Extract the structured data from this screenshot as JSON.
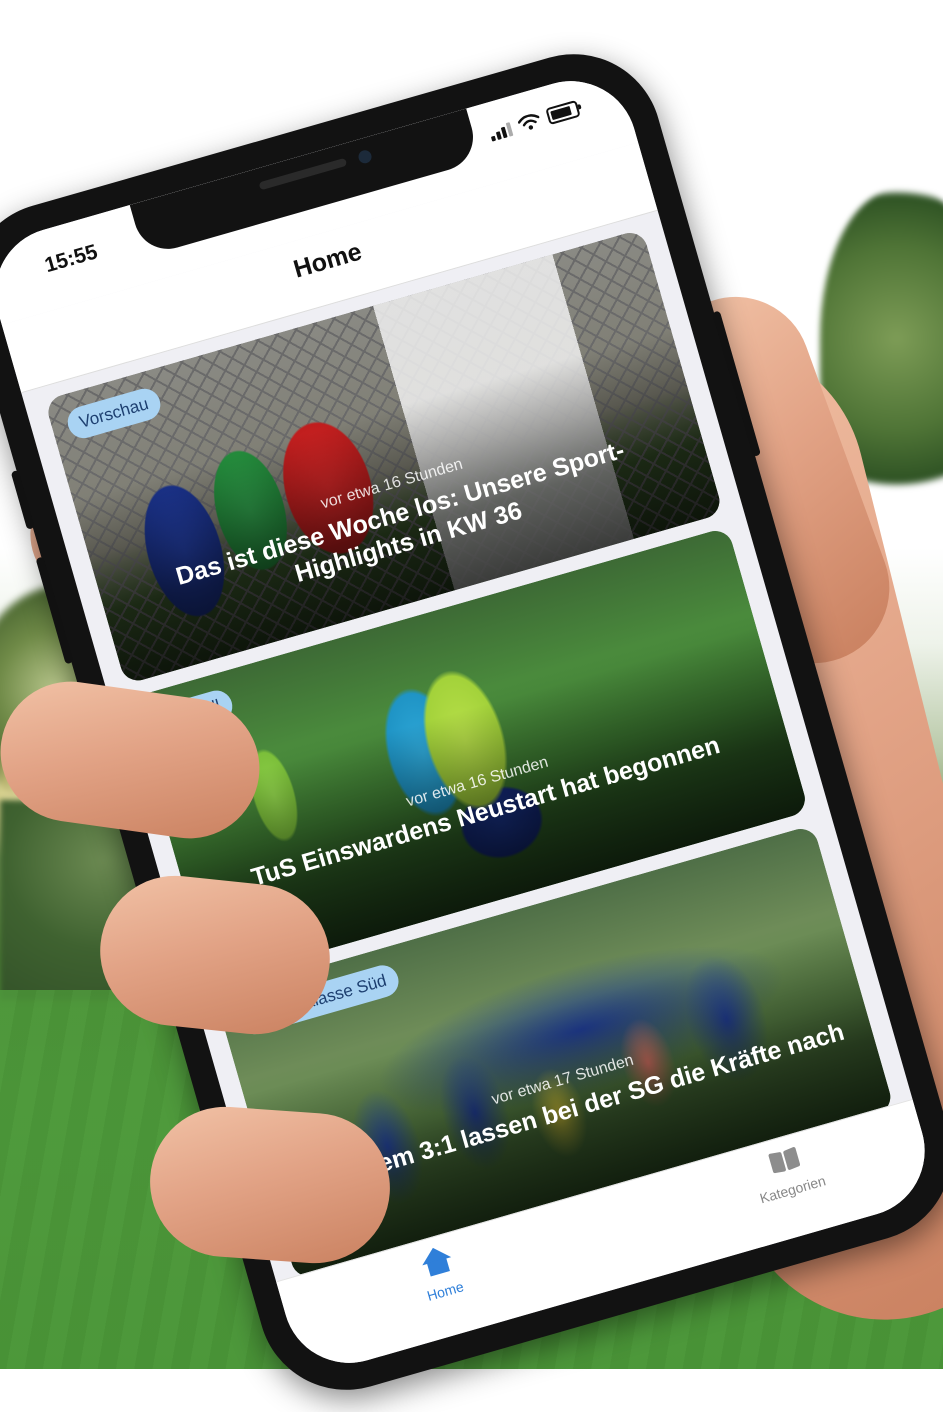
{
  "status_bar": {
    "time": "15:55"
  },
  "nav": {
    "title": "Home"
  },
  "feed": [
    {
      "tag": "Vorschau",
      "time": "vor etwa 16 Stunden",
      "title": "Das ist diese Woche los: Unsere Sport-Highlights in KW 36"
    },
    {
      "tag": "Fußball",
      "time": "vor etwa 16 Stunden",
      "title": "TuS Einswardens Neustart hat begonnen"
    },
    {
      "tag": "1. Kreisklasse Süd",
      "time": "vor etwa 17 Stunden",
      "title": "Nach dem 3:1 lassen bei der SG die Kräfte nach"
    }
  ],
  "tabs": [
    {
      "label": "Home",
      "icon": "home-icon",
      "active": true
    },
    {
      "label": "Kategorien",
      "icon": "book-icon",
      "active": false
    }
  ],
  "colors": {
    "accent": "#2f7fd9",
    "tag_bg": "#a9d3f3",
    "tag_text": "#1d3f70"
  }
}
